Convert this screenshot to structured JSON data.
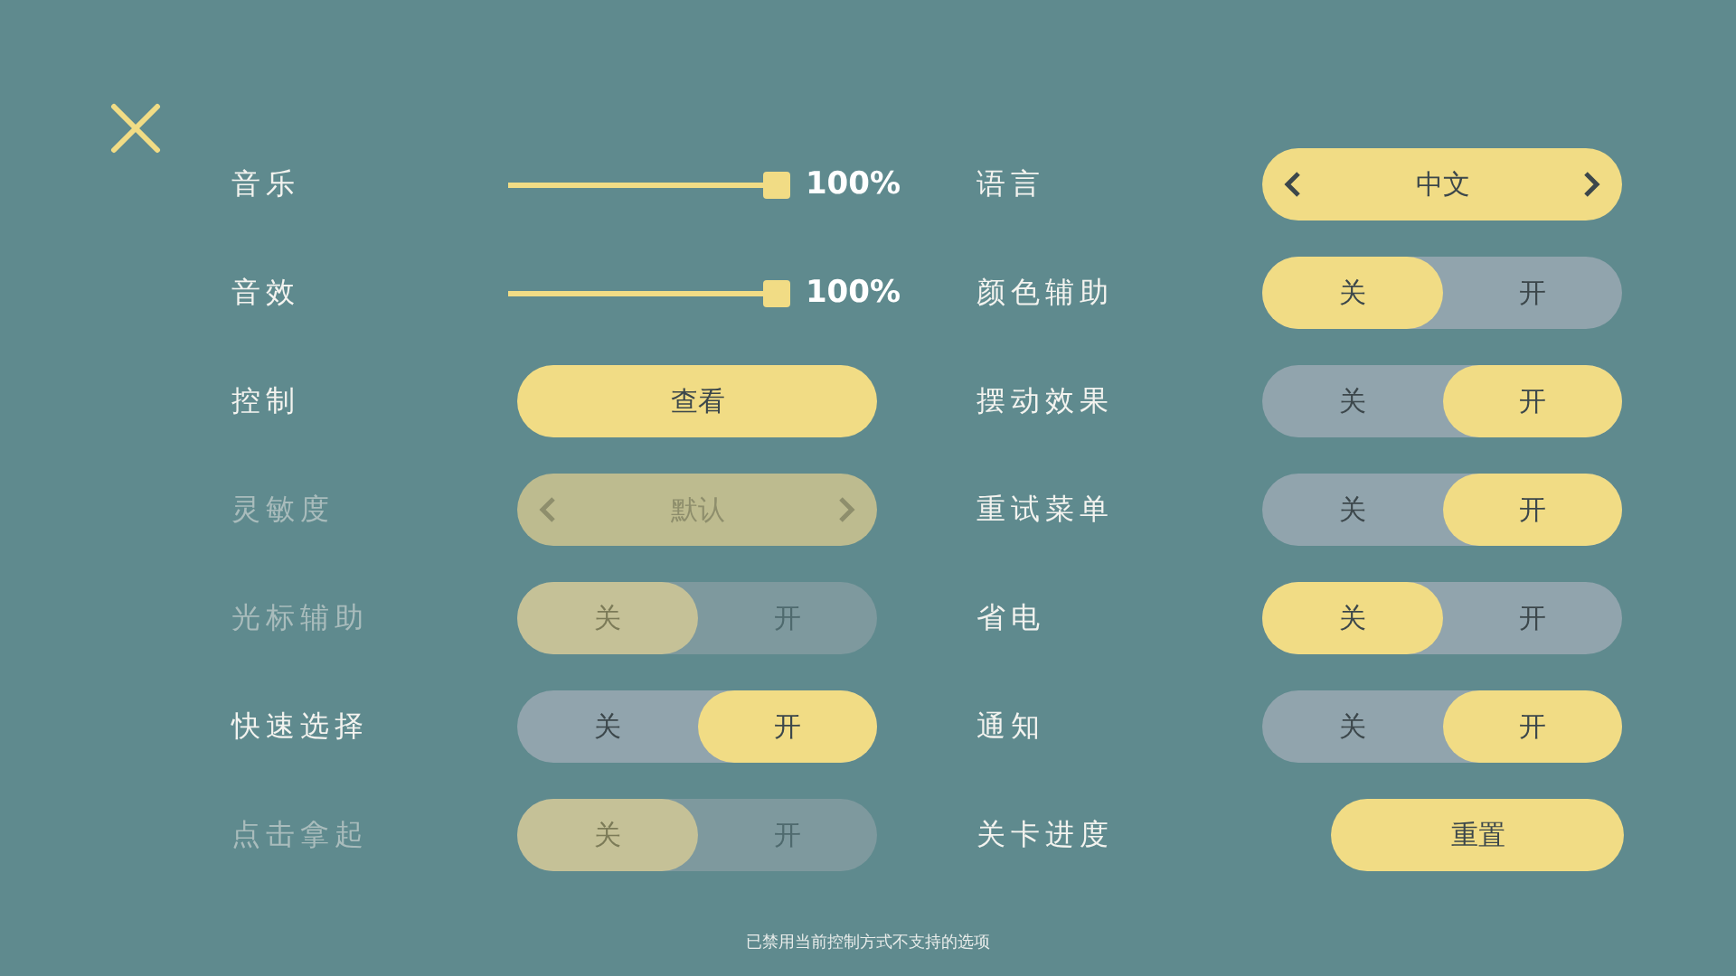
{
  "left": [
    {
      "kind": "slider",
      "label": "音乐",
      "disabled": false,
      "level": 1,
      "reading": "100%"
    },
    {
      "kind": "slider",
      "label": "音效",
      "disabled": false,
      "level": 1,
      "reading": "100%"
    },
    {
      "kind": "button",
      "label": "控制",
      "disabled": false,
      "value": "查看"
    },
    {
      "kind": "selector",
      "label": "灵敏度",
      "disabled": true,
      "value": "默认"
    },
    {
      "kind": "toggle",
      "label": "光标辅助",
      "disabled": true,
      "off_label": "关",
      "on_label": "开",
      "on": false
    },
    {
      "kind": "toggle",
      "label": "快速选择",
      "disabled": false,
      "off_label": "关",
      "on_label": "开",
      "on": true
    },
    {
      "kind": "toggle",
      "label": "点击拿起",
      "disabled": true,
      "off_label": "关",
      "on_label": "开",
      "on": false
    }
  ],
  "right": [
    {
      "kind": "selector",
      "label": "语言",
      "disabled": false,
      "value": "中文"
    },
    {
      "kind": "toggle",
      "label": "颜色辅助",
      "disabled": false,
      "off_label": "关",
      "on_label": "开",
      "on": false
    },
    {
      "kind": "toggle",
      "label": "摆动效果",
      "disabled": false,
      "off_label": "关",
      "on_label": "开",
      "on": true
    },
    {
      "kind": "toggle",
      "label": "重试菜单",
      "disabled": false,
      "off_label": "关",
      "on_label": "开",
      "on": true
    },
    {
      "kind": "toggle",
      "label": "省电",
      "disabled": false,
      "off_label": "关",
      "on_label": "开",
      "on": false
    },
    {
      "kind": "toggle",
      "label": "通知",
      "disabled": false,
      "off_label": "关",
      "on_label": "开",
      "on": true
    },
    {
      "kind": "button",
      "label": "关卡进度",
      "disabled": false,
      "value": "重置"
    }
  ],
  "footer": "已禁用当前控制方式不支持的选项"
}
